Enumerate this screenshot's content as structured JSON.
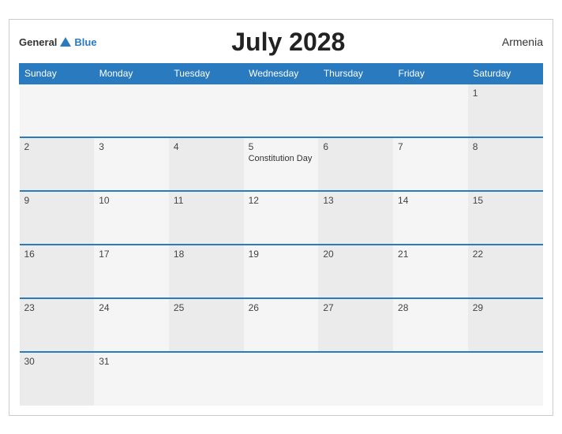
{
  "header": {
    "logo_general": "General",
    "logo_blue": "Blue",
    "title": "July 2028",
    "country": "Armenia"
  },
  "weekdays": [
    "Sunday",
    "Monday",
    "Tuesday",
    "Wednesday",
    "Thursday",
    "Friday",
    "Saturday"
  ],
  "weeks": [
    [
      {
        "day": "",
        "event": ""
      },
      {
        "day": "",
        "event": ""
      },
      {
        "day": "",
        "event": ""
      },
      {
        "day": "",
        "event": ""
      },
      {
        "day": "",
        "event": ""
      },
      {
        "day": "",
        "event": ""
      },
      {
        "day": "1",
        "event": ""
      }
    ],
    [
      {
        "day": "2",
        "event": ""
      },
      {
        "day": "3",
        "event": ""
      },
      {
        "day": "4",
        "event": ""
      },
      {
        "day": "5",
        "event": "Constitution Day"
      },
      {
        "day": "6",
        "event": ""
      },
      {
        "day": "7",
        "event": ""
      },
      {
        "day": "8",
        "event": ""
      }
    ],
    [
      {
        "day": "9",
        "event": ""
      },
      {
        "day": "10",
        "event": ""
      },
      {
        "day": "11",
        "event": ""
      },
      {
        "day": "12",
        "event": ""
      },
      {
        "day": "13",
        "event": ""
      },
      {
        "day": "14",
        "event": ""
      },
      {
        "day": "15",
        "event": ""
      }
    ],
    [
      {
        "day": "16",
        "event": ""
      },
      {
        "day": "17",
        "event": ""
      },
      {
        "day": "18",
        "event": ""
      },
      {
        "day": "19",
        "event": ""
      },
      {
        "day": "20",
        "event": ""
      },
      {
        "day": "21",
        "event": ""
      },
      {
        "day": "22",
        "event": ""
      }
    ],
    [
      {
        "day": "23",
        "event": ""
      },
      {
        "day": "24",
        "event": ""
      },
      {
        "day": "25",
        "event": ""
      },
      {
        "day": "26",
        "event": ""
      },
      {
        "day": "27",
        "event": ""
      },
      {
        "day": "28",
        "event": ""
      },
      {
        "day": "29",
        "event": ""
      }
    ],
    [
      {
        "day": "30",
        "event": ""
      },
      {
        "day": "31",
        "event": ""
      },
      {
        "day": "",
        "event": ""
      },
      {
        "day": "",
        "event": ""
      },
      {
        "day": "",
        "event": ""
      },
      {
        "day": "",
        "event": ""
      },
      {
        "day": "",
        "event": ""
      }
    ]
  ]
}
